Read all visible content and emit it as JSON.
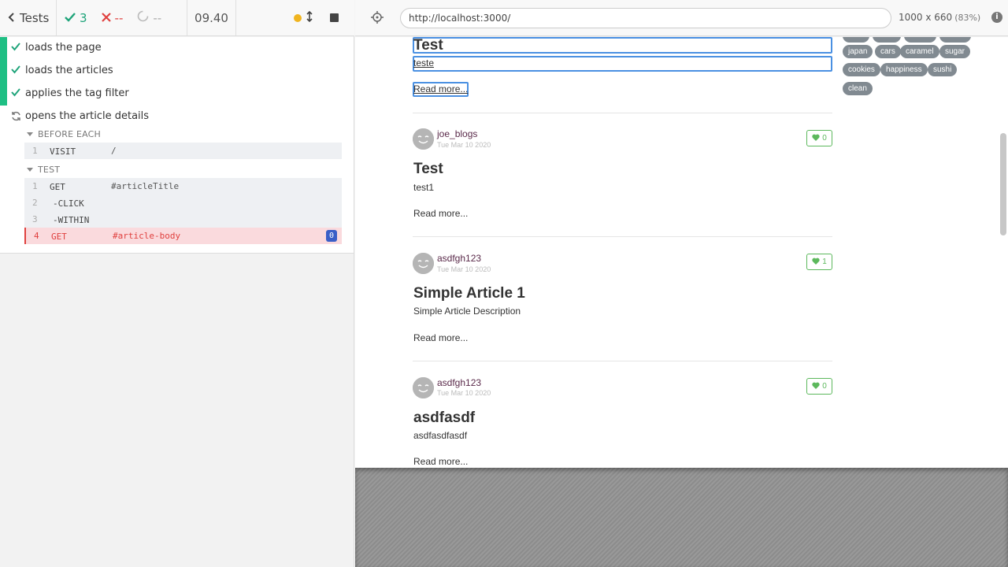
{
  "reporter": {
    "back_label": "Tests",
    "stats": {
      "passed": "3",
      "failed": "--",
      "pending": "--"
    },
    "duration": "09.40",
    "tests": [
      {
        "title": "loads the page",
        "state": "passed"
      },
      {
        "title": "loads the articles",
        "state": "passed"
      },
      {
        "title": "applies the tag filter",
        "state": "passed"
      },
      {
        "title": "opens the article details",
        "state": "running"
      }
    ],
    "hooks": {
      "before_each_title": "BEFORE EACH",
      "test_title": "TEST",
      "before_each_commands": [
        {
          "num": "1",
          "name": "VISIT",
          "message": "/"
        }
      ],
      "test_commands": [
        {
          "num": "1",
          "name": "GET",
          "message": "#articleTitle"
        },
        {
          "num": "2",
          "name": "-CLICK",
          "message": ""
        },
        {
          "num": "3",
          "name": "-WITHIN",
          "message": ""
        },
        {
          "num": "4",
          "name": "GET",
          "message": "#article-body",
          "badge": "0",
          "state": "failed"
        }
      ]
    }
  },
  "browser": {
    "url": "http://localhost:3000/",
    "viewport": "1000 x 660",
    "scale": "(83%)"
  },
  "app": {
    "top_article": {
      "title": "Test",
      "description": "teste",
      "read_more": "Read more..."
    },
    "articles": [
      {
        "author": "joe_blogs",
        "date": "Tue Mar 10 2020",
        "favorites": "0",
        "title": "Test",
        "description": "test1",
        "read_more": "Read more..."
      },
      {
        "author": "asdfgh123",
        "date": "Tue Mar 10 2020",
        "favorites": "1",
        "title": "Simple Article 1",
        "description": "Simple Article Description",
        "read_more": "Read more..."
      },
      {
        "author": "asdfgh123",
        "date": "Tue Mar 10 2020",
        "favorites": "0",
        "title": "asdfasdf",
        "description": "asdfasdfasdf",
        "read_more": "Read more..."
      }
    ],
    "tags": [
      "japan",
      "cars",
      "caramel",
      "sugar",
      "cookies",
      "happiness",
      "sushi",
      "clean"
    ]
  },
  "colors": {
    "pass": "#1fa47a",
    "fail": "#e0413f",
    "highlight": "#4a90e2",
    "favorite": "#5cb85c"
  }
}
